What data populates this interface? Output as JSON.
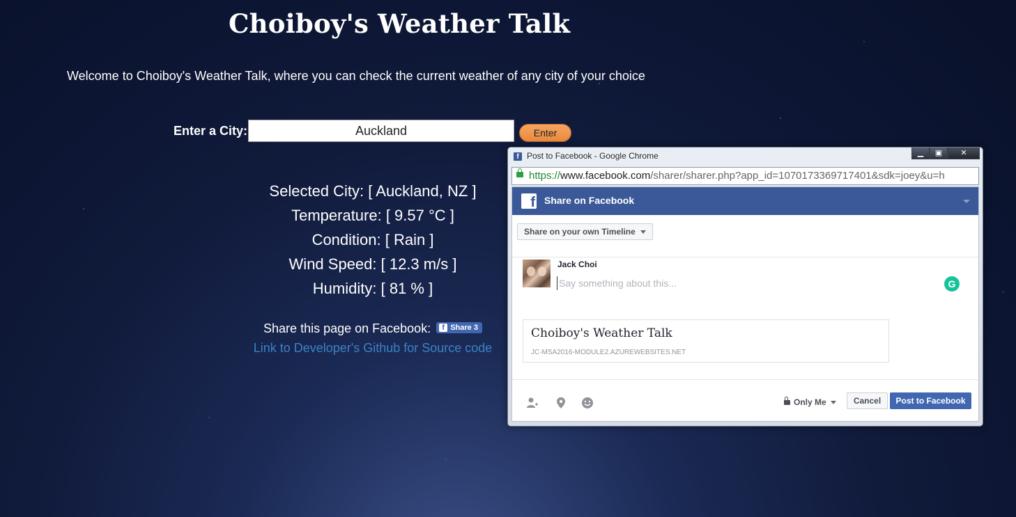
{
  "site": {
    "title": "Choiboy's Weather Talk",
    "welcome": "Welcome to Choiboy's Weather Talk, where you can check the current weather of any city of your choice"
  },
  "form": {
    "label": "Enter a City:",
    "value": "Auckland",
    "button": "Enter"
  },
  "weather": {
    "city": "Selected City: [ Auckland, NZ ]",
    "temperature": "Temperature: [ 9.57 °C ]",
    "condition": "Condition: [ Rain ]",
    "wind": "Wind Speed: [ 12.3 m/s ]",
    "humidity": "Humidity: [ 81 % ]"
  },
  "share": {
    "label": "Share this page on Facebook:",
    "button": "Share 3",
    "github_link": "Link to Developer's Github for Source code"
  },
  "popup": {
    "window_title": "Post to Facebook - Google Chrome",
    "url_protocol": "https://",
    "url_host": "www.facebook.com",
    "url_path": "/sharer/sharer.php?app_id=1070173369717401&sdk=joey&u=h",
    "header_title": "Share on Facebook",
    "timeline_select": "Share on your own Timeline",
    "user_name": "Jack Choi",
    "say_placeholder": "Say something about this...",
    "card_title": "Choiboy's Weather Talk",
    "card_domain": "JC-MSA2016-MODULE2.AZUREWEBSITES.NET",
    "privacy": "Only Me",
    "cancel": "Cancel",
    "post": "Post to Facebook"
  },
  "icons": {
    "grammarly": "G",
    "fb_letter": "f"
  },
  "colors": {
    "fb_blue": "#3b5998",
    "enter_button": "#f0934c",
    "link_blue": "#3b82c6"
  }
}
